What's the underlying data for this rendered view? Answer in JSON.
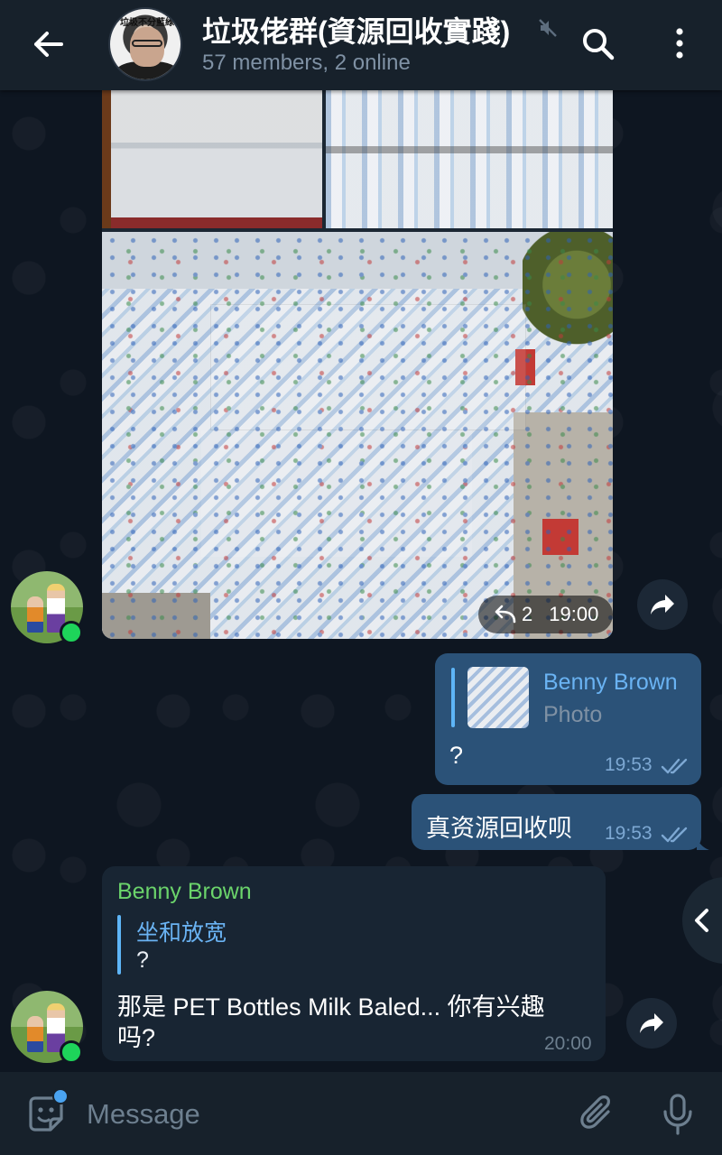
{
  "header": {
    "title": "垃圾佬群(資源回收實踐)",
    "subtitle": "57 members, 2 online",
    "avatar_caption": "垃圾不分藍綠"
  },
  "album": {
    "replies": "2",
    "time": "19:00"
  },
  "messages": [
    {
      "direction": "out",
      "reply_to_name": "Benny Brown",
      "reply_to_text": "Photo",
      "text": "?",
      "time": "19:53"
    },
    {
      "direction": "out",
      "text": "真资源回收呗",
      "time": "19:53"
    },
    {
      "direction": "in",
      "sender": "Benny Brown",
      "reply_to_name": "坐和放宽",
      "reply_to_text": "?",
      "text_line1": "那是 PET Bottles Milk Baled... 你有兴趣",
      "text_line2": "吗?",
      "time": "20:00"
    }
  ],
  "composer": {
    "placeholder": "Message"
  },
  "colors": {
    "header_bg": "#17212b",
    "chat_bg": "#0e1621",
    "bubble_out": "#2b5278",
    "bubble_in": "#182533",
    "accent_blue": "#6ab3f3",
    "sender_green": "#6bd46b",
    "online_green": "#1ed45a"
  },
  "icons": [
    "back-arrow-icon",
    "mute-icon",
    "search-icon",
    "more-vertical-icon",
    "reply-count-icon",
    "forward-icon",
    "double-check-icon",
    "chevron-left-icon",
    "emoji-sticker-icon",
    "paperclip-icon",
    "microphone-icon"
  ]
}
